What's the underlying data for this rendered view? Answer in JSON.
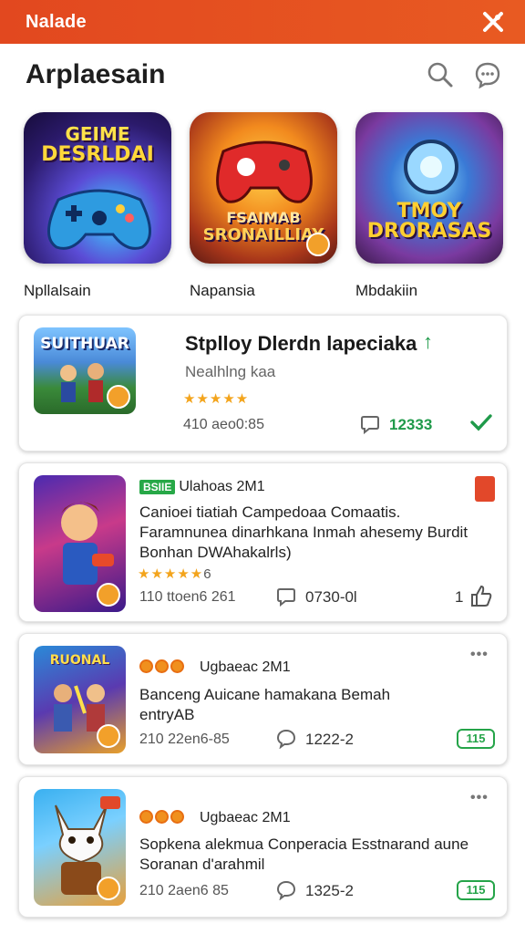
{
  "topbar": {
    "title": "Nalade"
  },
  "header": {
    "title": "Arplaesain"
  },
  "featured": [
    {
      "label": "Npllalsain",
      "art_text": [
        "GEIME",
        "DESRLDAI"
      ]
    },
    {
      "label": "Napansia",
      "art_text": [
        "FSAIMAB",
        "SRONAILLIAY"
      ]
    },
    {
      "label": "Mbdakiin",
      "art_text": [
        "TMOY",
        "DRORASAS"
      ]
    }
  ],
  "cards": [
    {
      "thumb_text": "SUITHUAR",
      "title": "Stplloy Dlerdn lapeciaka",
      "subtitle": "Nealhlng kaa",
      "stars": "★★★★★",
      "meta": "410 aeo0:85",
      "comments": "12333"
    },
    {
      "tag_badge": "BSIIE",
      "tag": "Ulahoas 2M1",
      "lines": [
        "Canioei tiatiah Campedoaa Comaatis.",
        "Faramnunea dinarhkana Inmah ahesemy Burdit",
        "Bonhan DWAhakalrls)"
      ],
      "stars": "★★★★★",
      "stars_suffix": "6",
      "meta": "110 ttoen6 261",
      "comments": "0730-0l",
      "likes": "1"
    },
    {
      "tag": "Ugbaeac 2M1",
      "thumb_text": "RUONAL",
      "lines": [
        "Banceng Auicane hamakana Bemah",
        "entryAB"
      ],
      "meta": "210 22en6-85",
      "comments": "1222-2",
      "pill": "115"
    },
    {
      "tag": "Ugbaeac 2M1",
      "lines": [
        "Sopkena alekmua Conperacia Esstnarand aune",
        "Soranan d'arahmil"
      ],
      "meta": "210 2aen6 85",
      "comments": "1325-2",
      "pill": "115"
    }
  ],
  "colors": {
    "brand": "#e2481f",
    "accent_green": "#1f9a4a",
    "star": "#f3a41c"
  }
}
